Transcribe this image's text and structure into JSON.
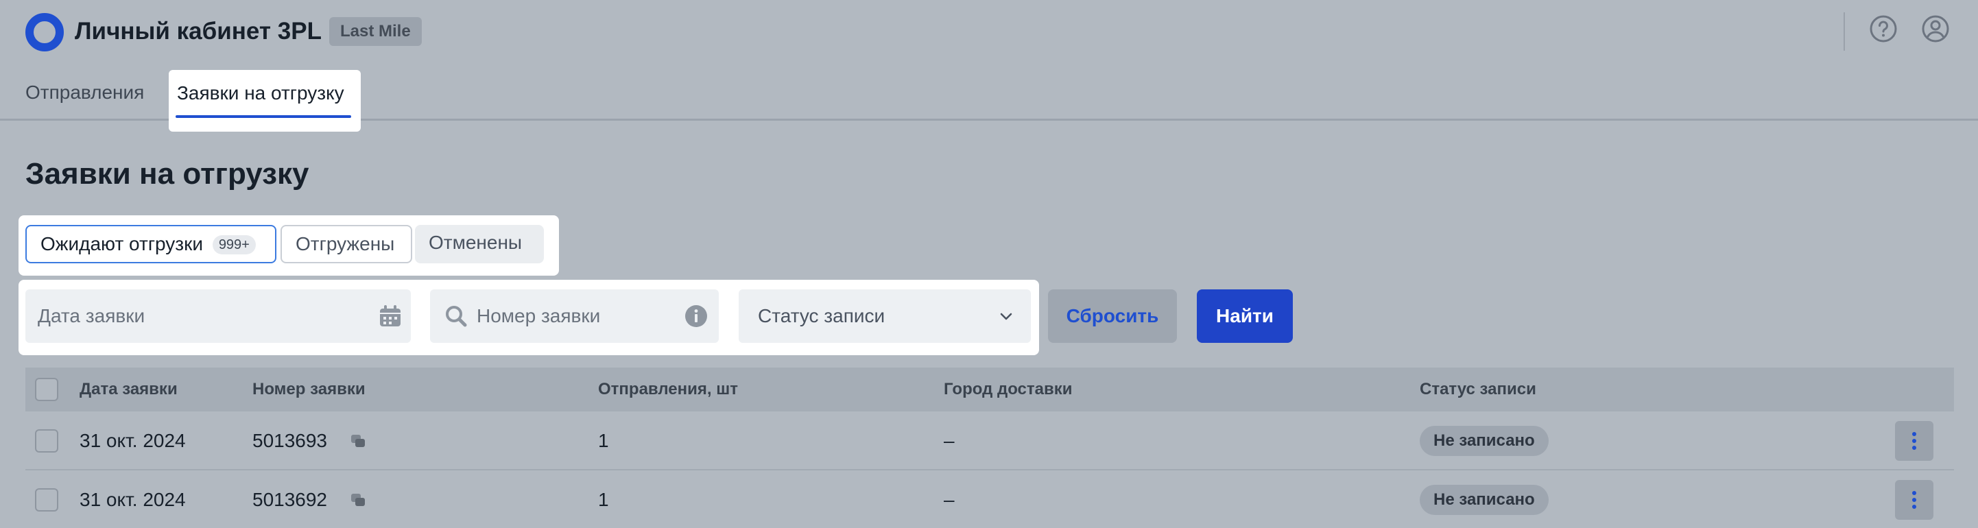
{
  "header": {
    "title": "Личный кабинет 3PL",
    "badge": "Last Mile",
    "help_icon": "help-circle-icon",
    "user_icon": "user-circle-icon"
  },
  "nav": {
    "tabs": [
      {
        "label": "Отправления",
        "active": false
      },
      {
        "label": "Заявки на отгрузку",
        "active": true
      }
    ]
  },
  "page": {
    "title": "Заявки на отгрузку"
  },
  "segments": [
    {
      "label": "Ожидают отгрузки",
      "count": "999+",
      "active": true
    },
    {
      "label": "Отгружены",
      "active": false
    },
    {
      "label": "Отменены",
      "active": false
    }
  ],
  "filters": {
    "date_placeholder": "Дата заявки",
    "number_placeholder": "Номер заявки",
    "status_placeholder": "Статус записи",
    "reset_label": "Сбросить",
    "find_label": "Найти"
  },
  "table": {
    "columns": [
      "Дата заявки",
      "Номер заявки",
      "Отправления, шт",
      "Город доставки",
      "Статус записи"
    ],
    "rows": [
      {
        "date": "31 окт. 2024",
        "number": "5013693",
        "shipments": "1",
        "city": "–",
        "status": "Не записано"
      },
      {
        "date": "31 окт. 2024",
        "number": "5013692",
        "shipments": "1",
        "city": "–",
        "status": "Не записано"
      }
    ]
  },
  "colors": {
    "accent": "#1f4fd0",
    "overlay_bg": "#b2b9c1",
    "highlight": "#ffffff"
  }
}
